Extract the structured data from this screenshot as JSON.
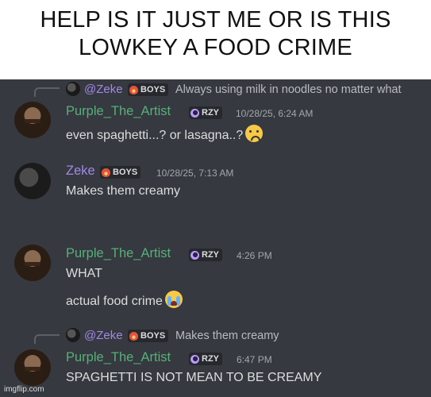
{
  "caption": "HELP IS IT JUST ME OR IS THIS LOWKEY A FOOD CRIME",
  "tags": {
    "rzy": "RZY",
    "boys": "BOYS"
  },
  "messages": [
    {
      "reply": {
        "name": "@Zeke",
        "text": "Always using milk in noodles no matter what"
      },
      "author": "Purple_The_Artist",
      "timestamp": "10/28/25, 6:24 AM",
      "lines": [
        "even spaghetti...? or lasagna..?"
      ],
      "emoji": "anxious-face-with-sweat"
    },
    {
      "author": "Zeke",
      "timestamp": "10/28/25, 7:13 AM",
      "lines": [
        "Makes them creamy"
      ]
    },
    {
      "author": "Purple_The_Artist",
      "timestamp": "4:26 PM",
      "lines": [
        "WHAT",
        "actual food crime"
      ],
      "emoji": "loudly-crying-face"
    },
    {
      "reply": {
        "name": "@Zeke",
        "text": "Makes them creamy"
      },
      "author": "Purple_The_Artist",
      "timestamp": "6:47 PM",
      "lines": [
        "SPAGHETTI IS NOT MEAN TO BE CREAMY"
      ]
    }
  ],
  "watermark": "imgflip.com",
  "colors": {
    "background": "#36393f",
    "purple_name": "#57b07a",
    "zeke_name": "#a287e8"
  }
}
